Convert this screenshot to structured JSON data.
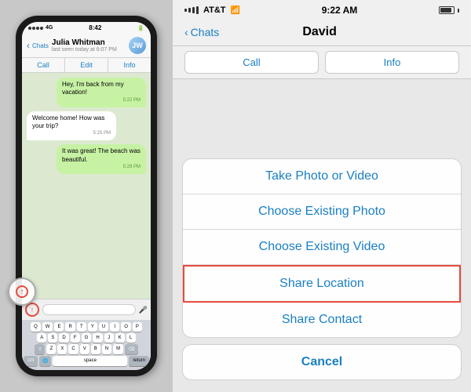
{
  "left_phone": {
    "status_bar": {
      "signal": "4G",
      "time": "8:42",
      "battery": "100%"
    },
    "header": {
      "back_label": "Chats",
      "contact_name": "Julia Whitman",
      "contact_status": "last seen today at 6:07 PM",
      "avatar_initials": "JW"
    },
    "actions": {
      "call": "Call",
      "edit": "Edit",
      "info": "Info"
    },
    "messages": [
      {
        "type": "sent",
        "text": "Hey, I'm back from my vacation!",
        "time": "5:22 PM"
      },
      {
        "type": "received",
        "text": "Welcome home! How was your trip?",
        "time": "5:25 PM"
      },
      {
        "type": "sent",
        "text": "It was great! The beach was beautiful.",
        "time": "5:29 PM"
      }
    ],
    "keyboard": {
      "rows": [
        [
          "Q",
          "W",
          "E",
          "R",
          "T",
          "Y",
          "U",
          "I",
          "O",
          "P"
        ],
        [
          "A",
          "S",
          "D",
          "F",
          "G",
          "H",
          "J",
          "K",
          "L"
        ],
        [
          "Z",
          "X",
          "C",
          "V",
          "B",
          "N",
          "M"
        ]
      ],
      "special_keys": {
        "shift": "⇧",
        "delete": "⌫",
        "numbers": "123",
        "globe": "🌐",
        "space": "space",
        "return": "return"
      }
    }
  },
  "right_panel": {
    "status_bar": {
      "carrier": "AT&T",
      "time": "9:22 AM",
      "battery": "100"
    },
    "nav": {
      "back_label": "Chats",
      "title": "David"
    },
    "tabs": {
      "call": "Call",
      "info": "Info"
    },
    "action_sheet": {
      "items": [
        {
          "id": "take-photo",
          "label": "Take Photo or Video",
          "highlighted": false
        },
        {
          "id": "choose-photo",
          "label": "Choose Existing Photo",
          "highlighted": false
        },
        {
          "id": "choose-video",
          "label": "Choose Existing Video",
          "highlighted": false
        },
        {
          "id": "share-location",
          "label": "Share Location",
          "highlighted": true
        },
        {
          "id": "share-contact",
          "label": "Share Contact",
          "highlighted": false
        }
      ],
      "cancel_label": "Cancel"
    }
  }
}
